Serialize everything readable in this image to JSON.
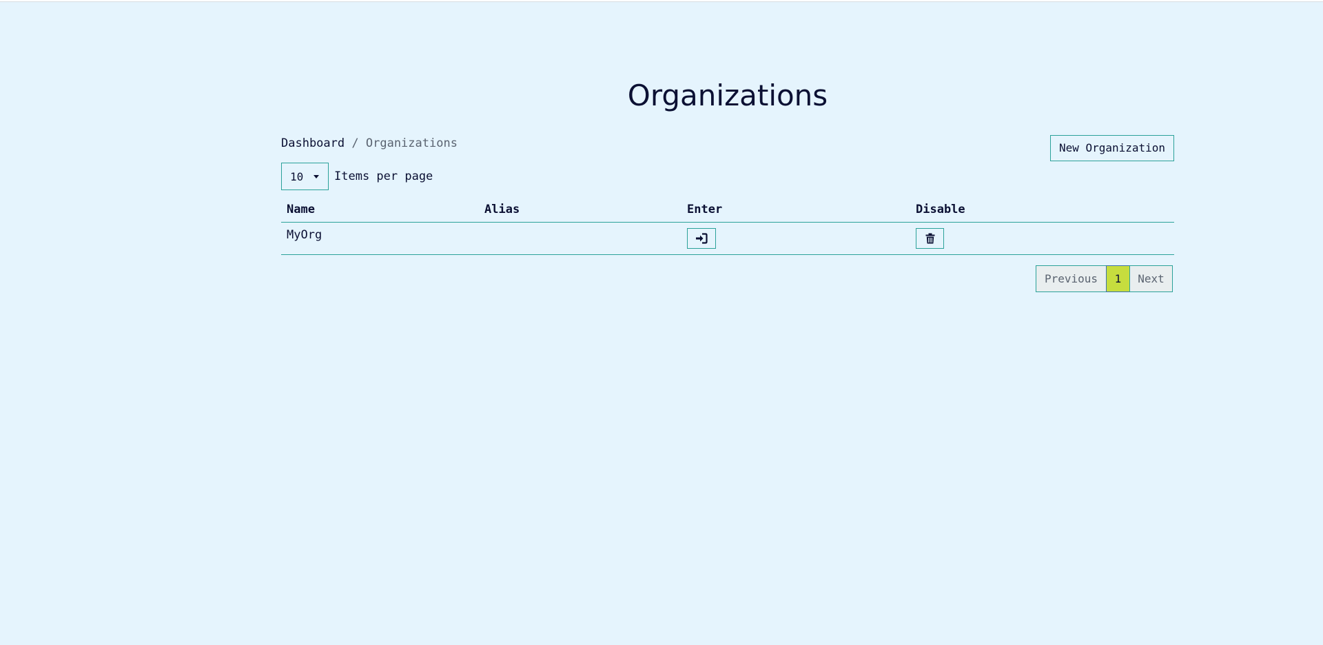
{
  "page": {
    "title": "Organizations"
  },
  "breadcrumb": {
    "dashboard": "Dashboard",
    "separator": "/",
    "current": "Organizations"
  },
  "actions": {
    "new_organization": "New Organization"
  },
  "per_page": {
    "selected": "10",
    "label": "Items per page"
  },
  "table": {
    "headers": {
      "name": "Name",
      "alias": "Alias",
      "enter": "Enter",
      "disable": "Disable"
    },
    "rows": [
      {
        "name": "MyOrg",
        "alias": "",
        "enter_icon": "sign-in-icon",
        "disable_icon": "trash-icon"
      }
    ]
  },
  "pagination": {
    "previous": "Previous",
    "current_page": "1",
    "next": "Next"
  },
  "colors": {
    "background": "#e5f4fd",
    "accent_border": "#2aa199",
    "text": "#0b1033",
    "active_page": "#c6dd3e"
  }
}
